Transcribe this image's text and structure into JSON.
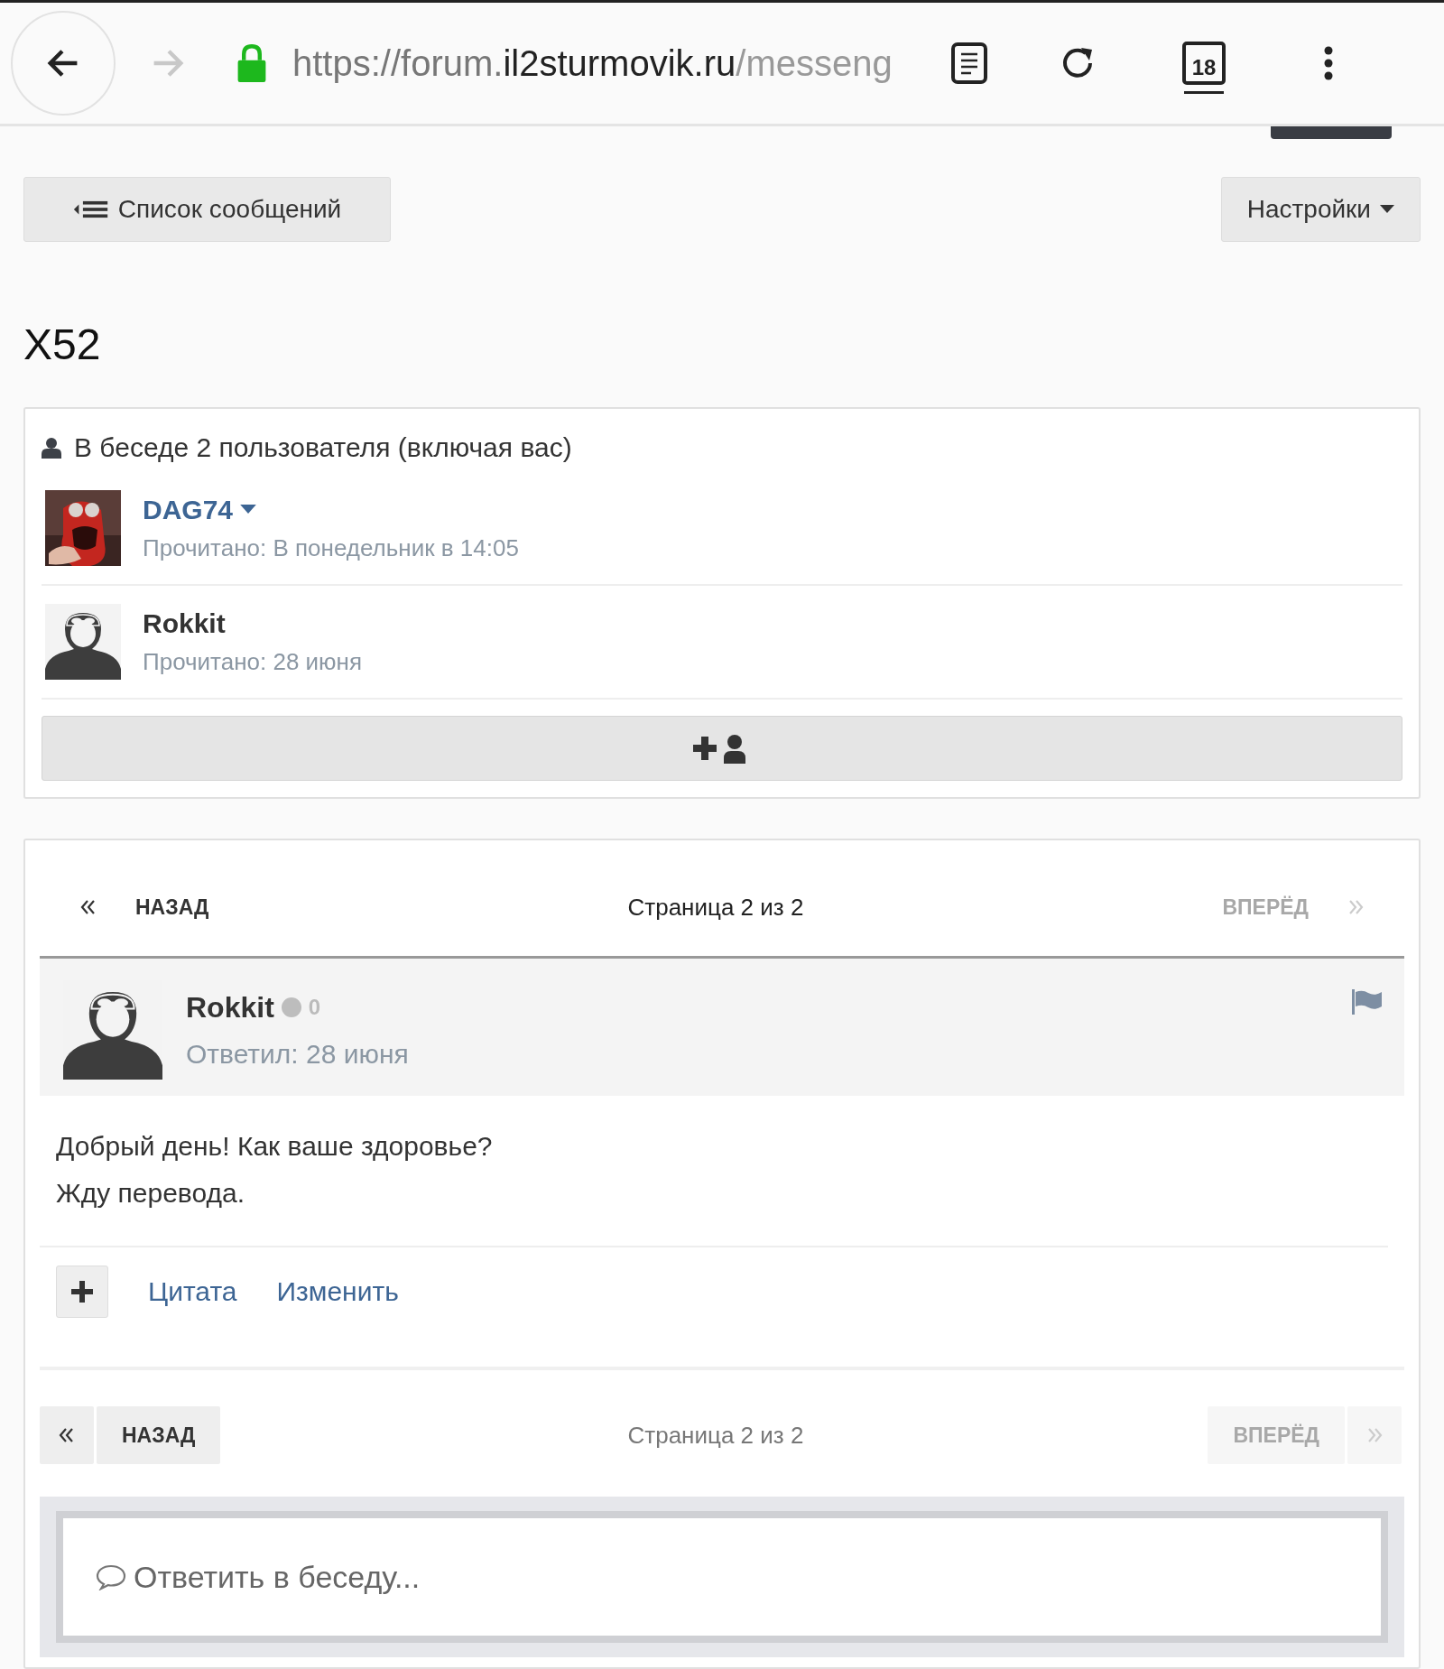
{
  "browser": {
    "url_scheme": "https://forum.",
    "url_domain": "il2sturmovik.ru",
    "url_path": "/messeng",
    "tab_count": "18"
  },
  "toolbar": {
    "messages_button": "Список сообщений",
    "settings_button": "Настройки"
  },
  "title": "X52",
  "participants": {
    "heading": "В беседе 2 пользователя (включая вас)",
    "users": [
      {
        "name": "DAG74",
        "read": "Прочитано: В понедельник в 14:05",
        "kind": "link",
        "photo": true
      },
      {
        "name": "Rokkit",
        "read": "Прочитано: 28 июня",
        "kind": "plain",
        "photo": false
      }
    ]
  },
  "pagination_top": {
    "prev": {
      "label": "НАЗАД",
      "disabled": false
    },
    "page": "Страница 2 из 2",
    "next": {
      "label": "ВПЕРЁД",
      "disabled": true
    }
  },
  "post": {
    "author": "Rokkit",
    "reputation": "0",
    "date": "Ответил: 28 июня",
    "lines": [
      "Добрый день! Как ваше здоровье?",
      "Жду перевода."
    ],
    "actions": [
      "Цитата",
      "Изменить"
    ]
  },
  "pagination_bottom": {
    "prev": {
      "label": "НАЗАД",
      "disabled": false
    },
    "page": "Страница 2 из 2",
    "next": {
      "label": "ВПЕРЁД",
      "disabled": true
    }
  },
  "reply": {
    "placeholder": "Ответить в беседу..."
  }
}
